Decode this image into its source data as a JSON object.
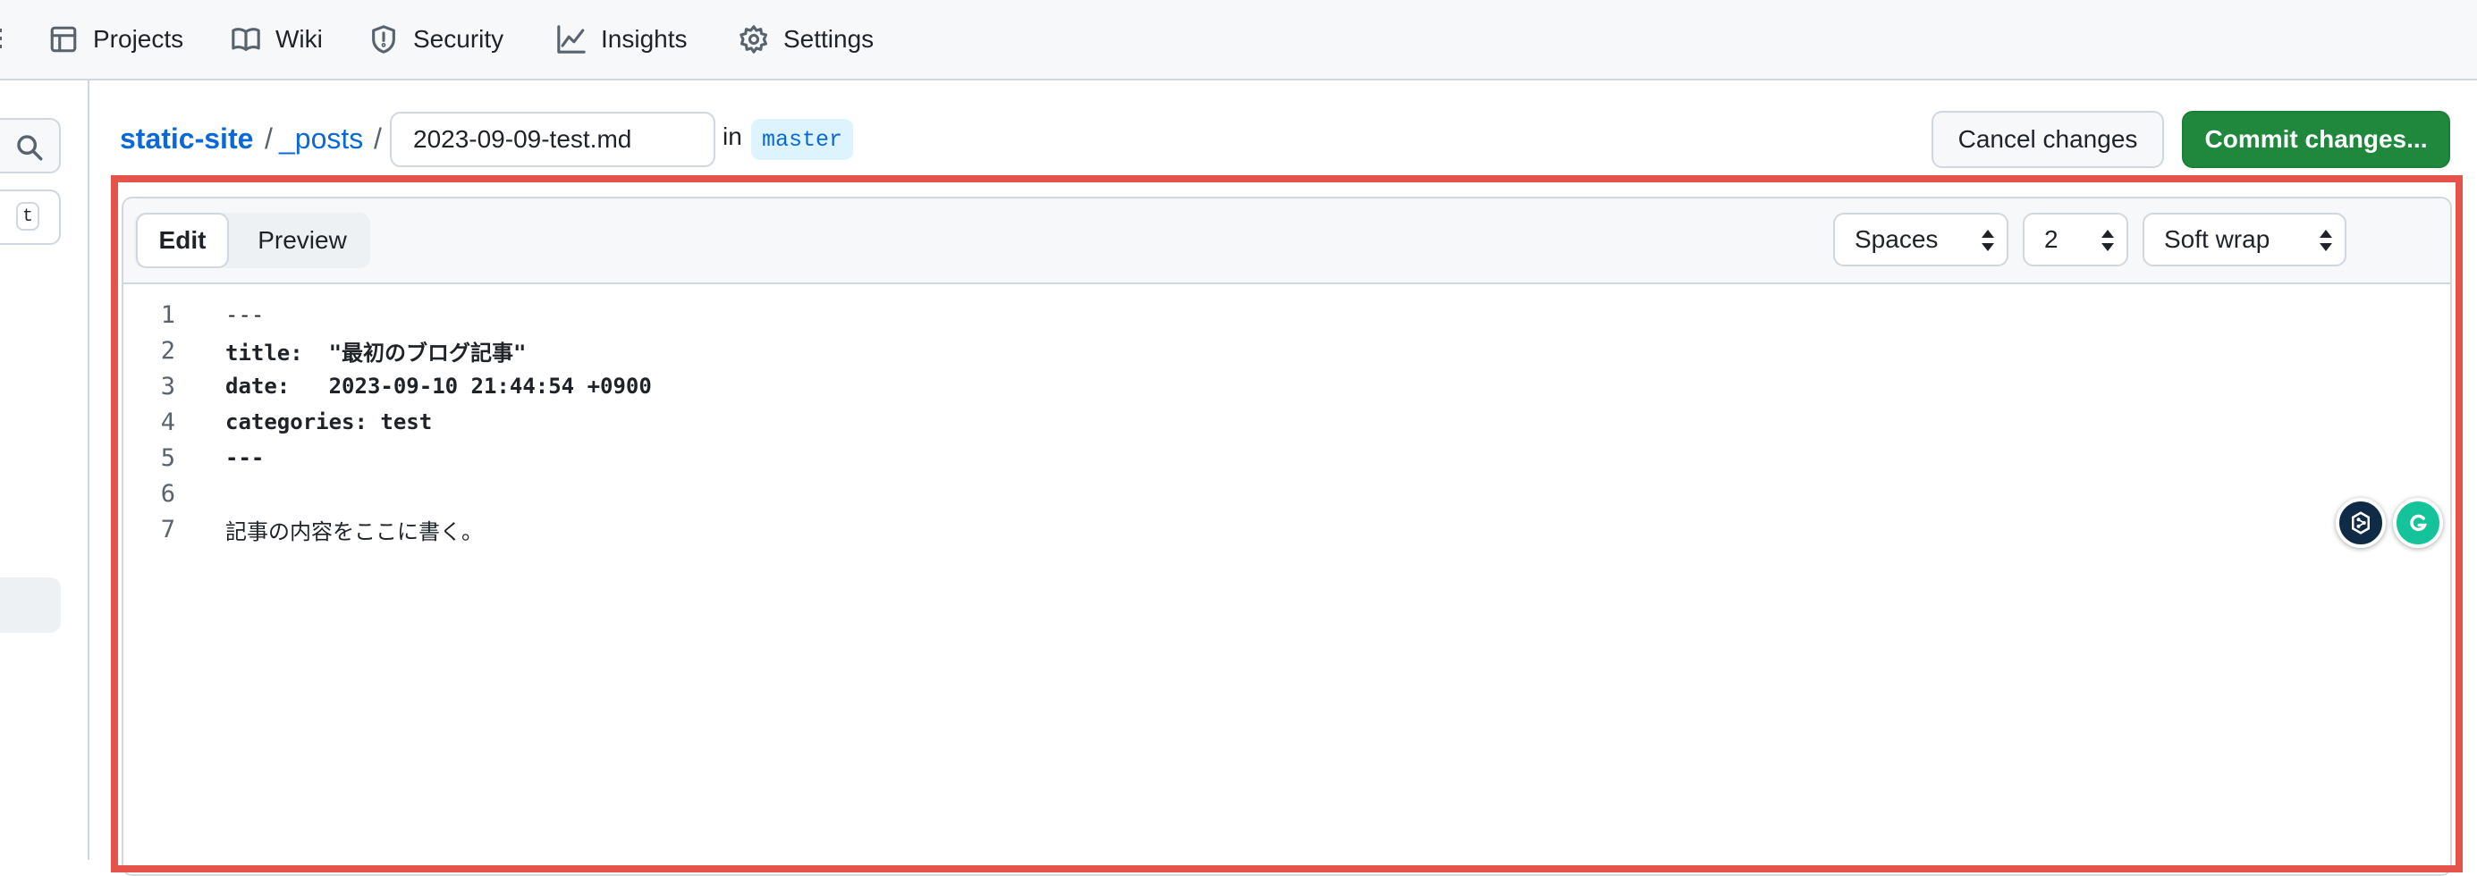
{
  "nav": {
    "items": [
      {
        "label": "Projects",
        "icon": "table-icon"
      },
      {
        "label": "Wiki",
        "icon": "book-icon"
      },
      {
        "label": "Security",
        "icon": "shield-icon"
      },
      {
        "label": "Insights",
        "icon": "graph-icon"
      },
      {
        "label": "Settings",
        "icon": "gear-icon"
      }
    ]
  },
  "sidebar": {
    "filter_key": "t"
  },
  "breadcrumb": {
    "repo": "static-site",
    "separator": "/",
    "folder": "_posts",
    "filename": "2023-09-09-test.md",
    "in_label": "in",
    "branch": "master"
  },
  "actions": {
    "cancel_label": "Cancel changes",
    "commit_label": "Commit changes..."
  },
  "editor": {
    "tabs": {
      "edit": "Edit",
      "preview": "Preview"
    },
    "indent_mode": "Spaces",
    "indent_size": "2",
    "wrap_mode": "Soft wrap",
    "lines": [
      {
        "num": "1",
        "text": "---"
      },
      {
        "num": "2",
        "text": "title:  \"最初のブログ記事\""
      },
      {
        "num": "3",
        "text": "date:   2023-09-10 21:44:54 +0900"
      },
      {
        "num": "4",
        "text": "categories: test"
      },
      {
        "num": "5",
        "text": "---"
      },
      {
        "num": "6",
        "text": ""
      },
      {
        "num": "7",
        "text": "記事の内容をここに書く。"
      }
    ]
  },
  "colors": {
    "accent": "#0969da",
    "commit": "#1f883d",
    "highlight": "#e5534b"
  }
}
